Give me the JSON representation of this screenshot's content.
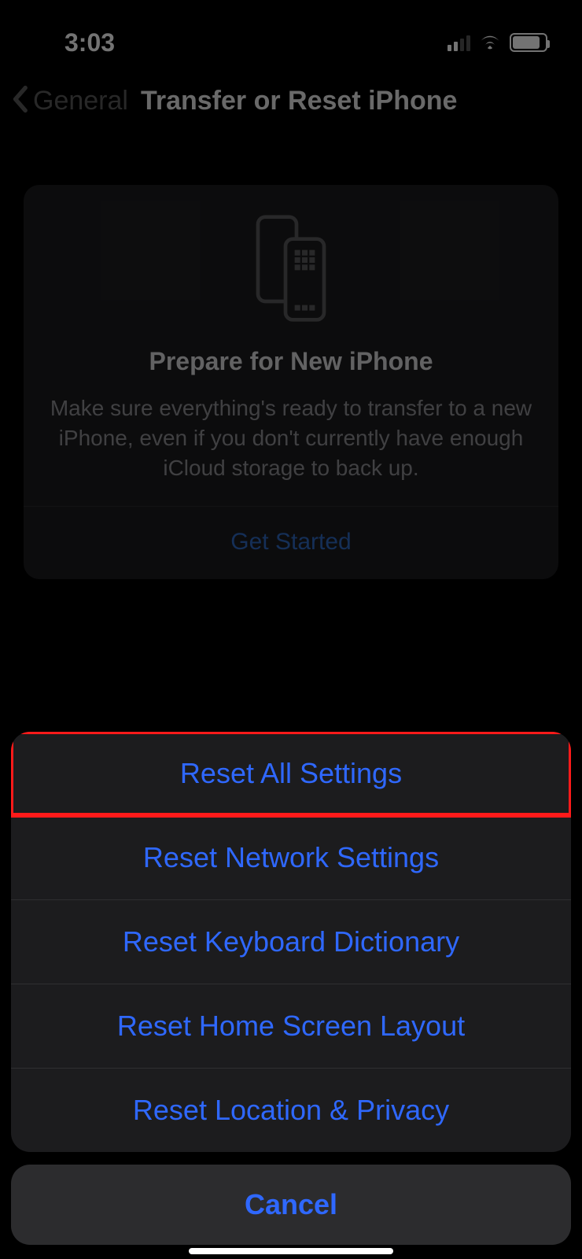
{
  "status": {
    "time": "3:03"
  },
  "nav": {
    "back_label": "General",
    "title": "Transfer or Reset iPhone"
  },
  "prepare_card": {
    "title": "Prepare for New iPhone",
    "body": "Make sure everything's ready to transfer to a new iPhone, even if you don't currently have enough iCloud storage to back up.",
    "action": "Get Started"
  },
  "sheet": {
    "options": [
      "Reset All Settings",
      "Reset Network Settings",
      "Reset Keyboard Dictionary",
      "Reset Home Screen Layout",
      "Reset Location & Privacy"
    ],
    "cancel": "Cancel"
  },
  "colors": {
    "link": "#2f68ff",
    "highlight": "#ff1a1a"
  }
}
